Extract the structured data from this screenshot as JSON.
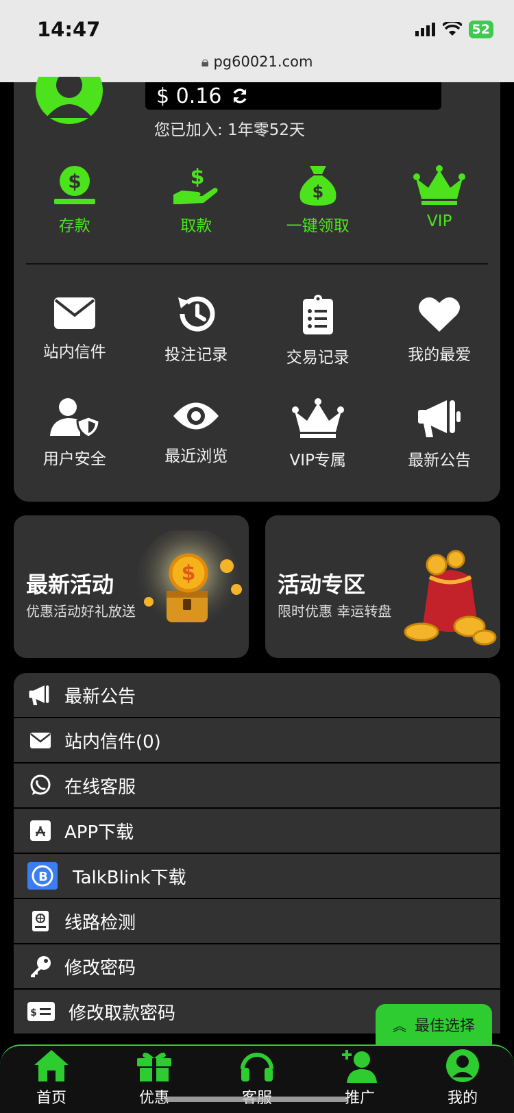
{
  "status": {
    "time": "14:47",
    "battery": "52"
  },
  "browser": {
    "url": "pg60021.com"
  },
  "account": {
    "balance": "$ 0.16",
    "joined": "您已加入: 1年零52天"
  },
  "quick_actions": [
    {
      "label": "存款",
      "icon": "money-coin-icon"
    },
    {
      "label": "取款",
      "icon": "hand-dollar-icon"
    },
    {
      "label": "一键领取",
      "icon": "money-bag-icon"
    },
    {
      "label": "VIP",
      "icon": "crown-icon"
    }
  ],
  "grid_row1": [
    {
      "label": "站内信件",
      "icon": "envelope-icon"
    },
    {
      "label": "投注记录",
      "icon": "history-icon"
    },
    {
      "label": "交易记录",
      "icon": "clipboard-list-icon"
    },
    {
      "label": "我的最爱",
      "icon": "heart-icon"
    }
  ],
  "grid_row2": [
    {
      "label": "用户安全",
      "icon": "user-shield-icon"
    },
    {
      "label": "最近浏览",
      "icon": "eye-icon"
    },
    {
      "label": "VIP专属",
      "icon": "crown-icon"
    },
    {
      "label": "最新公告",
      "icon": "megaphone-icon"
    }
  ],
  "promos": [
    {
      "title": "最新活动",
      "subtitle": "优惠活动好礼放送"
    },
    {
      "title": "活动专区",
      "subtitle": "限时优惠 幸运转盘"
    }
  ],
  "menu": [
    {
      "label": "最新公告",
      "icon": "megaphone-icon"
    },
    {
      "label": "站内信件(0)",
      "icon": "envelope-icon"
    },
    {
      "label": "在线客服",
      "icon": "whatsapp-icon"
    },
    {
      "label": "APP下载",
      "icon": "app-store-icon"
    },
    {
      "label": "TalkBlink下载",
      "icon": "talkblink-icon"
    },
    {
      "label": "线路检测",
      "icon": "globe-book-icon"
    },
    {
      "label": "修改密码",
      "icon": "key-icon"
    },
    {
      "label": "修改取款密码",
      "icon": "money-check-icon"
    }
  ],
  "best_choice": "最佳选择",
  "bottom_nav": [
    {
      "label": "首页",
      "icon": "home-icon"
    },
    {
      "label": "优惠",
      "icon": "gift-icon"
    },
    {
      "label": "客服",
      "icon": "headset-icon"
    },
    {
      "label": "推广",
      "icon": "user-plus-icon"
    },
    {
      "label": "我的",
      "icon": "user-circle-icon"
    }
  ],
  "colors": {
    "accent": "#4ce31c",
    "card": "#323232",
    "background": "#000000"
  }
}
